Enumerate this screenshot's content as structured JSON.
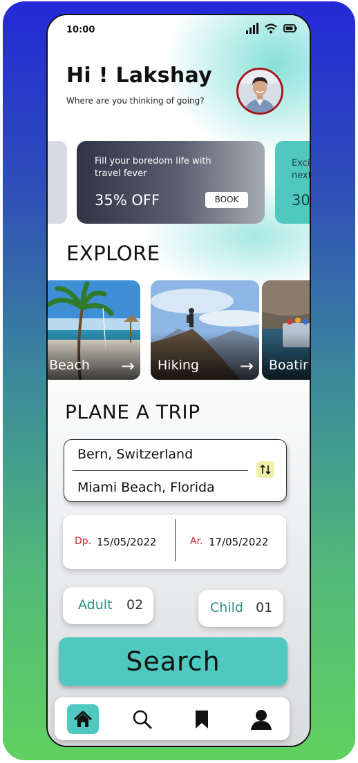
{
  "status": {
    "time": "10:00"
  },
  "header": {
    "greeting": "Hi ! Lakshay",
    "subtitle": "Where are you thinking of going?"
  },
  "promo_cards": [
    {
      "text": "Fill your boredom life with travel fever",
      "discount": "35% OFF",
      "button": "BOOK"
    },
    {
      "text": "Exci\nnext",
      "discount": "30"
    }
  ],
  "explore": {
    "title": "EXPLORE",
    "items": [
      {
        "label": "Beach",
        "arrow": "→"
      },
      {
        "label": "Hiking",
        "arrow": "→"
      },
      {
        "label": "Boatir"
      }
    ]
  },
  "plan": {
    "title": "PLANE A TRIP",
    "from": "Bern, Switzerland",
    "to": "Miami Beach, Florida",
    "departure_label": "Dp.",
    "departure_date": "15/05/2022",
    "arrival_label": "Ar.",
    "arrival_date": "17/05/2022",
    "adult_label": "Adult",
    "adult_count": "02",
    "child_label": "Child",
    "child_count": "01"
  },
  "search_button": "Search",
  "colors": {
    "accent": "#4fc9c0",
    "date_label": "#c6242c",
    "passenger_label": "#2d8c84",
    "swap_bg": "#eef2a8",
    "avatar_border": "#a4161a"
  },
  "nav": [
    "home-icon",
    "search-icon",
    "bookmark-icon",
    "profile-icon"
  ]
}
